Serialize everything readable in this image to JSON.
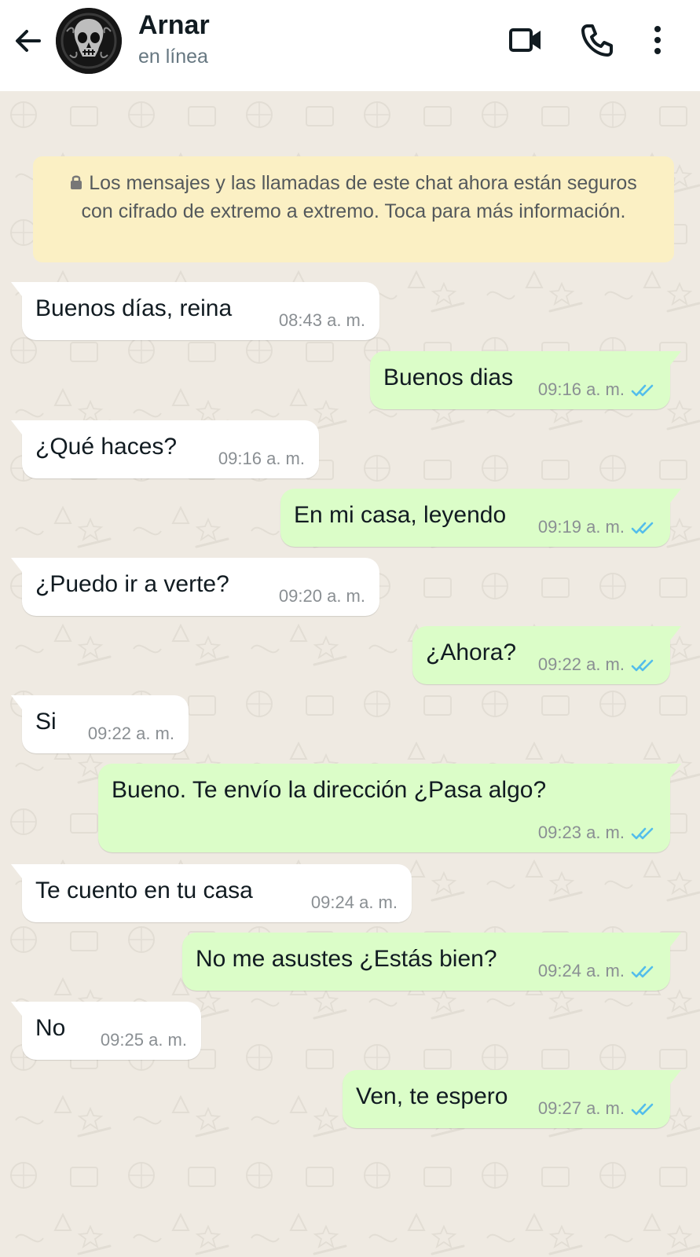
{
  "contact": {
    "name": "Arnar",
    "status": "en línea"
  },
  "notice": {
    "text": "Los mensajes y las llamadas de este chat ahora están seguros con cifrado de extremo a extremo. Toca para más información."
  },
  "messages": [
    {
      "dir": "in",
      "text": "Buenos días, reina",
      "time": "08:43 a. m."
    },
    {
      "dir": "out",
      "text": "Buenos dias",
      "time": "09:16 a. m.",
      "read": true
    },
    {
      "dir": "in",
      "text": "¿Qué haces?",
      "time": "09:16 a. m."
    },
    {
      "dir": "out",
      "text": "En mi casa, leyendo",
      "time": "09:19 a. m.",
      "read": true
    },
    {
      "dir": "in",
      "text": "¿Puedo ir a verte?",
      "time": "09:20 a. m."
    },
    {
      "dir": "out",
      "text": "¿Ahora?",
      "time": "09:22 a. m.",
      "read": true
    },
    {
      "dir": "in",
      "text": "Si",
      "time": "09:22 a. m."
    },
    {
      "dir": "out",
      "text": "Bueno. Te envío la dirección ¿Pasa algo?",
      "time": "09:23 a. m.",
      "read": true
    },
    {
      "dir": "in",
      "text": "Te cuento en tu casa",
      "time": "09:24 a. m."
    },
    {
      "dir": "out",
      "text": "No me asustes ¿Estás bien?",
      "time": "09:24 a. m.",
      "read": true
    },
    {
      "dir": "in",
      "text": "No",
      "time": "09:25 a. m."
    },
    {
      "dir": "out",
      "text": "Ven, te espero",
      "time": "09:27 a. m.",
      "read": true
    }
  ],
  "icons": {
    "back": "arrow-left-icon",
    "video": "video-camera-icon",
    "call": "phone-icon",
    "menu": "more-vertical-icon",
    "lock": "lock-icon",
    "read": "double-check-icon"
  },
  "colors": {
    "chat_background": "#efeae2",
    "incoming_bubble": "#ffffff",
    "outgoing_bubble": "#dbfdc8",
    "notice_background": "#fbf0c4",
    "read_ticks": "#53bdeb"
  }
}
